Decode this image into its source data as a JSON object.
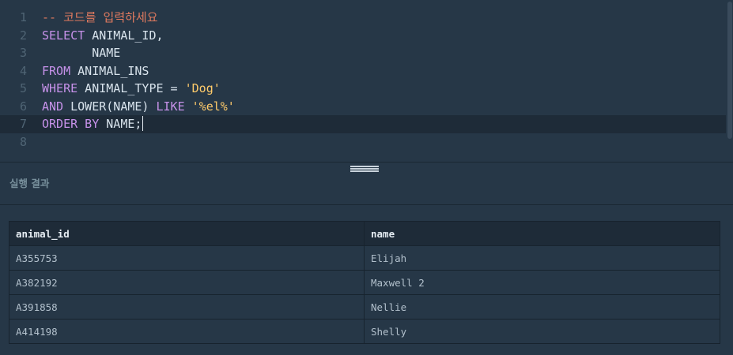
{
  "editor": {
    "lines": [
      {
        "num": "1",
        "tokens": [
          {
            "t": "cm",
            "v": "-- 코드를 입력하세요"
          }
        ]
      },
      {
        "num": "2",
        "tokens": [
          {
            "t": "kw",
            "v": "SELECT"
          },
          {
            "t": "id",
            "v": " ANIMAL_ID,"
          }
        ]
      },
      {
        "num": "3",
        "tokens": [
          {
            "t": "id",
            "v": "       NAME"
          }
        ]
      },
      {
        "num": "4",
        "tokens": [
          {
            "t": "kw",
            "v": "FROM"
          },
          {
            "t": "id",
            "v": " ANIMAL_INS"
          }
        ]
      },
      {
        "num": "5",
        "tokens": [
          {
            "t": "kw",
            "v": "WHERE"
          },
          {
            "t": "id",
            "v": " ANIMAL_TYPE = "
          },
          {
            "t": "str",
            "v": "'Dog'"
          }
        ]
      },
      {
        "num": "6",
        "tokens": [
          {
            "t": "kw",
            "v": "AND"
          },
          {
            "t": "id",
            "v": " LOWER(NAME) "
          },
          {
            "t": "kw",
            "v": "LIKE"
          },
          {
            "t": "id",
            "v": " "
          },
          {
            "t": "str",
            "v": "'%el%'"
          }
        ]
      },
      {
        "num": "7",
        "tokens": [
          {
            "t": "kw",
            "v": "ORDER BY"
          },
          {
            "t": "id",
            "v": " NAME;"
          }
        ]
      },
      {
        "num": "8",
        "tokens": []
      }
    ],
    "active_line": "7"
  },
  "results": {
    "title": "실행 결과",
    "columns": [
      "animal_id",
      "name"
    ],
    "rows": [
      [
        "A355753",
        "Elijah"
      ],
      [
        "A382192",
        "Maxwell 2"
      ],
      [
        "A391858",
        "Nellie"
      ],
      [
        "A414198",
        "Shelly"
      ]
    ]
  },
  "colors": {
    "background": "#263747",
    "keyword": "#c792ea",
    "string": "#ffcb6b",
    "comment": "#e07a5f",
    "identifier": "#d8e3ec",
    "line_number": "#4f6474",
    "active_line_bg": "#1e2b38"
  }
}
